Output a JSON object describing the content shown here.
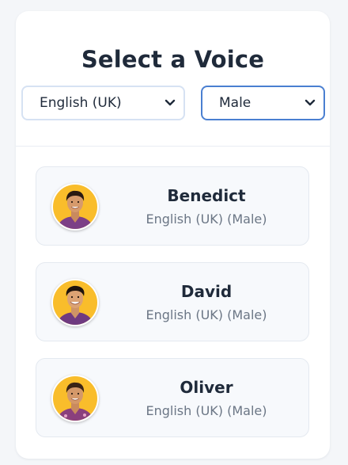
{
  "title": "Select a Voice",
  "filters": {
    "language": {
      "selected": "English (UK)"
    },
    "gender": {
      "selected": "Male"
    }
  },
  "voices": [
    {
      "name": "Benedict",
      "description": "English (UK) (Male)"
    },
    {
      "name": "David",
      "description": "English (UK) (Male)"
    },
    {
      "name": "Oliver",
      "description": "English (UK) (Male)"
    }
  ],
  "colors": {
    "accent_border": "#4a7fd1",
    "avatar_background": "#f9bd2b",
    "title_text": "#1f2a3a",
    "secondary_text": "#6b7685"
  },
  "icons": {
    "dropdown": "chevron-down-icon",
    "avatar": "person-avatar"
  }
}
